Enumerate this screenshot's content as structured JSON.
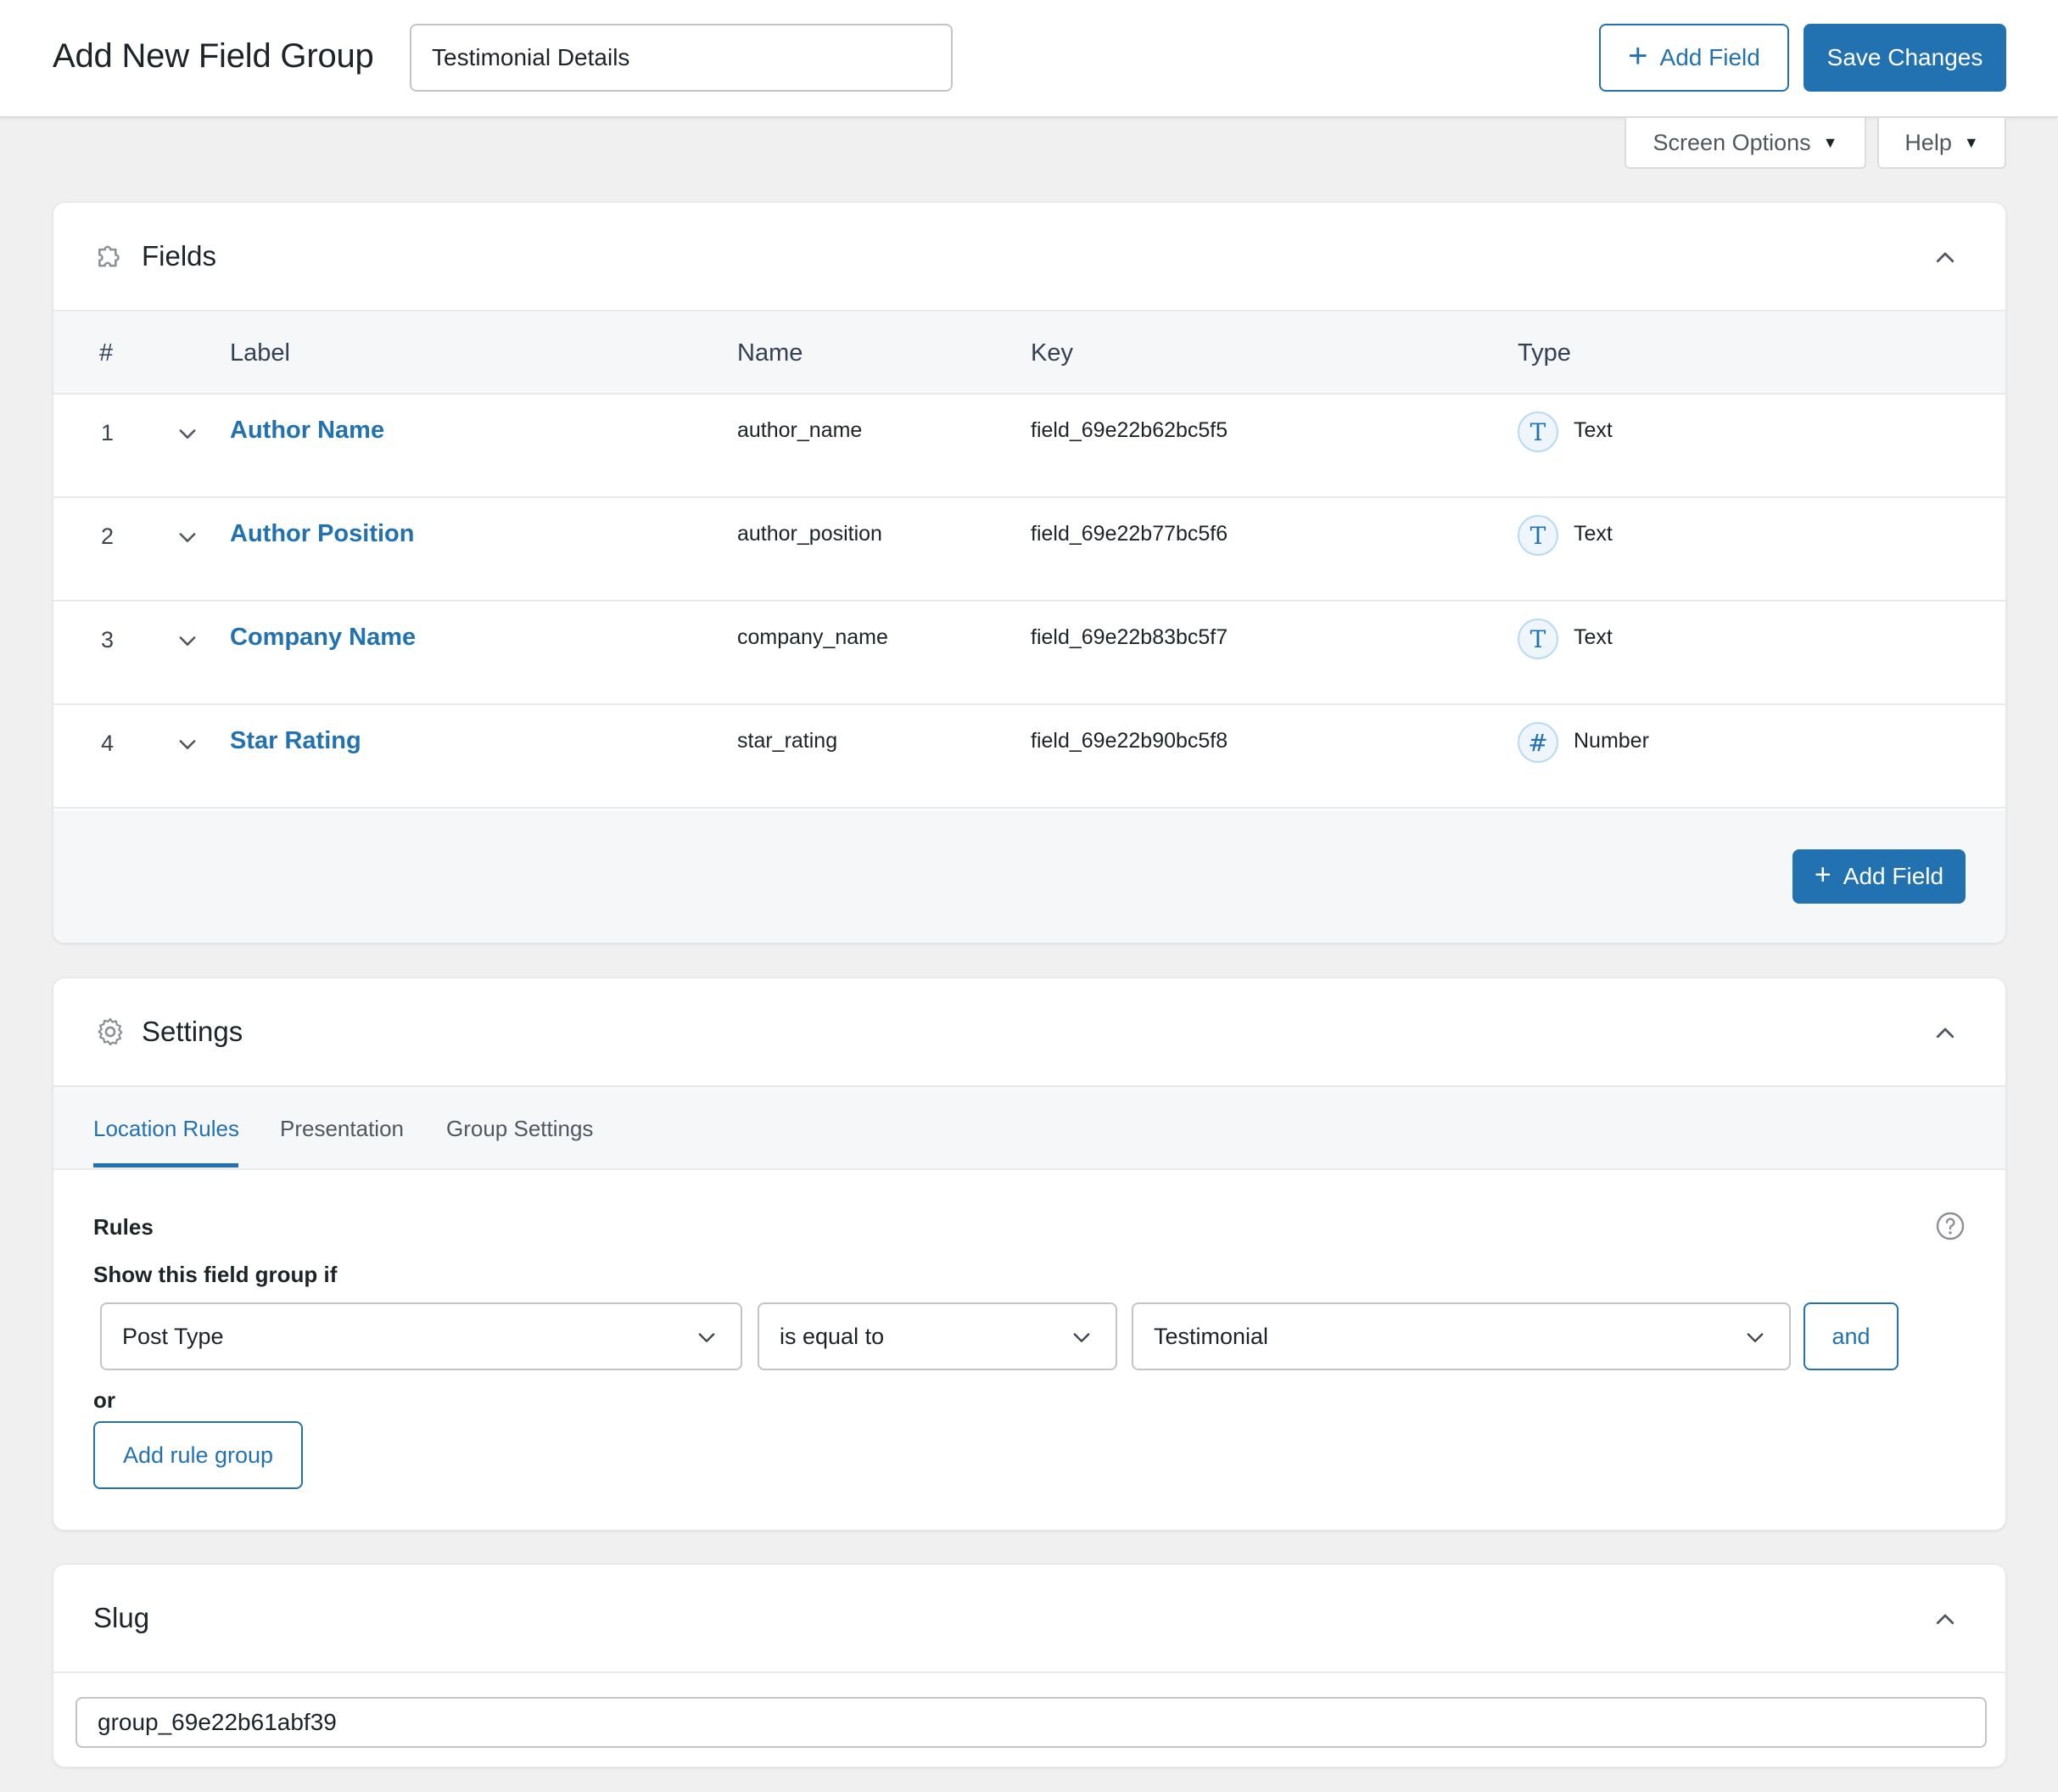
{
  "header": {
    "title": "Add New Field Group",
    "group_name_value": "Testimonial Details",
    "add_field_label": "Add Field",
    "save_label": "Save Changes"
  },
  "screen_meta": {
    "screen_options_label": "Screen Options",
    "help_label": "Help"
  },
  "fields_panel": {
    "title": "Fields",
    "columns": [
      "#",
      "Label",
      "Name",
      "Key",
      "Type"
    ],
    "rows": [
      {
        "num": "1",
        "label": "Author Name",
        "name": "author_name",
        "key": "field_69e22b62bc5f5",
        "type": "Text",
        "type_icon": "T"
      },
      {
        "num": "2",
        "label": "Author Position",
        "name": "author_position",
        "key": "field_69e22b77bc5f6",
        "type": "Text",
        "type_icon": "T"
      },
      {
        "num": "3",
        "label": "Company Name",
        "name": "company_name",
        "key": "field_69e22b83bc5f7",
        "type": "Text",
        "type_icon": "T"
      },
      {
        "num": "4",
        "label": "Star Rating",
        "name": "star_rating",
        "key": "field_69e22b90bc5f8",
        "type": "Number",
        "type_icon": "#"
      }
    ],
    "add_field_label": "Add Field"
  },
  "settings_panel": {
    "title": "Settings",
    "tabs": [
      "Location Rules",
      "Presentation",
      "Group Settings"
    ],
    "rules_label": "Rules",
    "show_if_label": "Show this field group if",
    "rule": {
      "param": "Post Type",
      "operator": "is equal to",
      "value": "Testimonial"
    },
    "and_label": "and",
    "or_label": "or",
    "add_rule_group_label": "Add rule group"
  },
  "slug_panel": {
    "title": "Slug",
    "value": "group_69e22b61abf39"
  },
  "colors": {
    "accent": "#2271b1",
    "background": "#f0f0f1"
  }
}
